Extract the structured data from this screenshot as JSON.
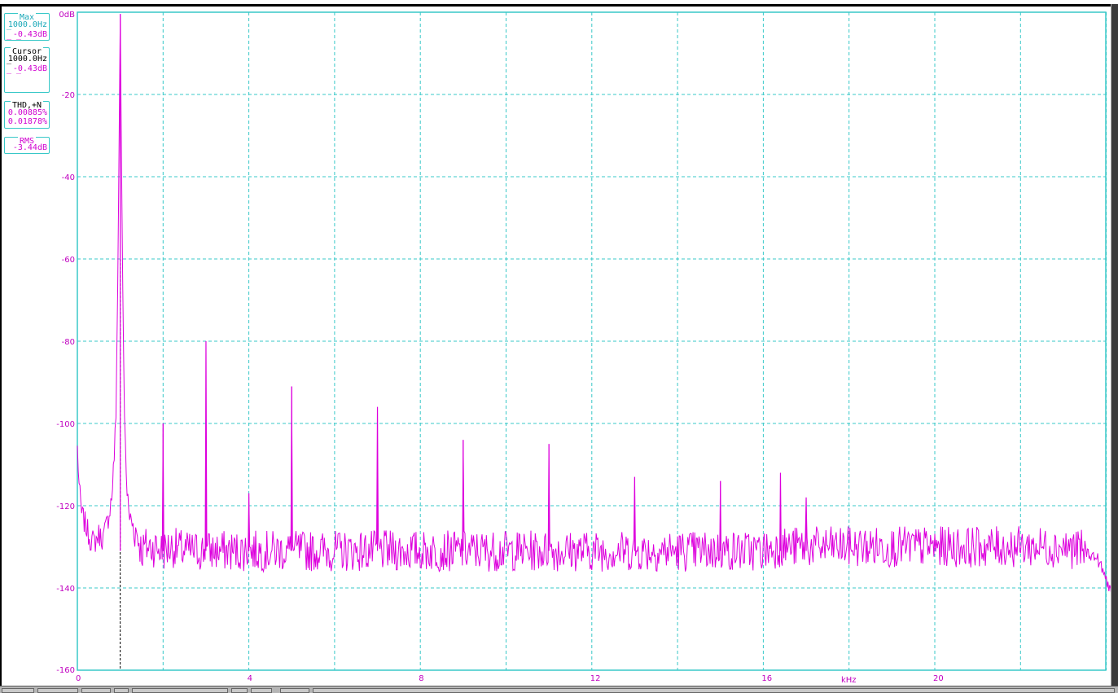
{
  "boxes": {
    "max": {
      "title": "Max",
      "freq": "1000.0Hz",
      "level": "-0.43dB"
    },
    "cursor": {
      "title": "Cursor",
      "freq": "1000.0Hz",
      "level": "-0.43dB"
    },
    "thd": {
      "title": "THD,+N",
      "thd": "0.00885%",
      "thdn": "0.01878%"
    },
    "rms": {
      "title": "RMS",
      "level": "-3.44dB"
    }
  },
  "colors": {
    "trace": "#dd00dd",
    "grid": "#38c8c8",
    "axis_text": "#c000c0",
    "cursor": "#000000"
  },
  "chart_data": {
    "type": "line",
    "xlabel": "kHz",
    "ylabel": "",
    "ylim": [
      -160,
      0
    ],
    "xlim": [
      0,
      24.8
    ],
    "y_ticks": [
      0,
      -20,
      -40,
      -60,
      -80,
      -100,
      -120,
      -140,
      -160
    ],
    "y_tick_labels": [
      "0dB",
      "-20",
      "-40",
      "-60",
      "-80",
      "-100",
      "-120",
      "-140",
      "-160"
    ],
    "x_ticks": [
      0,
      4,
      8,
      12,
      16,
      20
    ],
    "x_tick_labels": [
      "0",
      "4",
      "8",
      "12",
      "16",
      "20"
    ],
    "x_gridlines": [
      0,
      2,
      4,
      6,
      8,
      10,
      12,
      14,
      16,
      18,
      20,
      22,
      24
    ],
    "grid": true,
    "cursor_x": 1.0,
    "noise_floor": -131,
    "peaks": [
      {
        "x": 1.0,
        "y": -0.43
      },
      {
        "x": 2.0,
        "y": -100
      },
      {
        "x": 3.0,
        "y": -80
      },
      {
        "x": 4.0,
        "y": -117
      },
      {
        "x": 5.0,
        "y": -91
      },
      {
        "x": 7.0,
        "y": -96
      },
      {
        "x": 9.0,
        "y": -104
      },
      {
        "x": 11.0,
        "y": -105
      },
      {
        "x": 13.0,
        "y": -113
      },
      {
        "x": 15.0,
        "y": -114
      },
      {
        "x": 16.4,
        "y": -112
      },
      {
        "x": 17.0,
        "y": -118
      }
    ],
    "series": [
      {
        "x": [
          0.0,
          0.05,
          0.1,
          0.2,
          0.3,
          0.4,
          0.5,
          0.6,
          0.7,
          0.8,
          0.85,
          0.9,
          0.95,
          1.0,
          1.05,
          1.1,
          1.15,
          1.2,
          1.3,
          1.4,
          1.5,
          1.6,
          1.8,
          2.0,
          2.2,
          2.5,
          3.0,
          3.5,
          4.0,
          4.5,
          5.0,
          6.0,
          7.0,
          8.0,
          9.0,
          10.0,
          11.0,
          12.0,
          13.0,
          14.0,
          15.0,
          16.0,
          16.4,
          17.0,
          18.0,
          19.0,
          20.0,
          21.0,
          22.0,
          23.0,
          23.5,
          23.8,
          24.0,
          24.2,
          24.4,
          24.6
        ],
        "y": [
          -106,
          -117,
          -122,
          -125,
          -128,
          -129,
          -127,
          -128,
          -124,
          -118,
          -110,
          -99,
          -60,
          -0.43,
          -60,
          -98,
          -115,
          -122,
          -125,
          -127,
          -131,
          -130,
          -130,
          -131,
          -130,
          -131,
          -131,
          -131,
          -131,
          -131,
          -131,
          -131,
          -131,
          -131,
          -131,
          -131,
          -131,
          -131,
          -131,
          -131,
          -131,
          -131,
          -130,
          -130,
          -130,
          -130,
          -130,
          -130,
          -130,
          -130,
          -131,
          -133,
          -138,
          -143,
          -150,
          -159
        ]
      }
    ]
  }
}
